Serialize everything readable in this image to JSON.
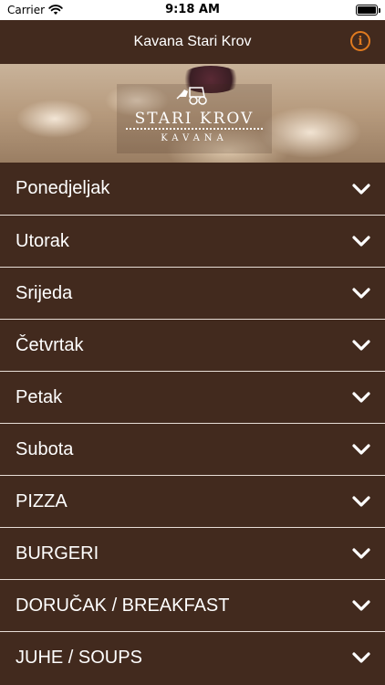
{
  "status_bar": {
    "carrier": "Carrier",
    "time": "9:18 AM",
    "wifi_icon": "wifi-icon",
    "battery_icon": "battery-icon"
  },
  "nav": {
    "title": "Kavana Stari Krov",
    "info_icon": "info-icon",
    "info_glyph": "i",
    "accent_color": "#e07a1f"
  },
  "hero": {
    "logo_text": "STARI KROV",
    "logo_subtext": "KAVANA"
  },
  "menu": {
    "chevron_icon": "chevron-down-icon",
    "items": [
      {
        "label": "Ponedjeljak"
      },
      {
        "label": "Utorak"
      },
      {
        "label": "Srijeda"
      },
      {
        "label": "Četvrtak"
      },
      {
        "label": "Petak"
      },
      {
        "label": "Subota"
      },
      {
        "label": "PIZZA"
      },
      {
        "label": "BURGERI"
      },
      {
        "label": "DORUČAK / BREAKFAST"
      },
      {
        "label": "JUHE / SOUPS"
      }
    ]
  },
  "colors": {
    "background": "#422a1e",
    "divider": "#e7ddd6",
    "text": "#ffffff"
  }
}
